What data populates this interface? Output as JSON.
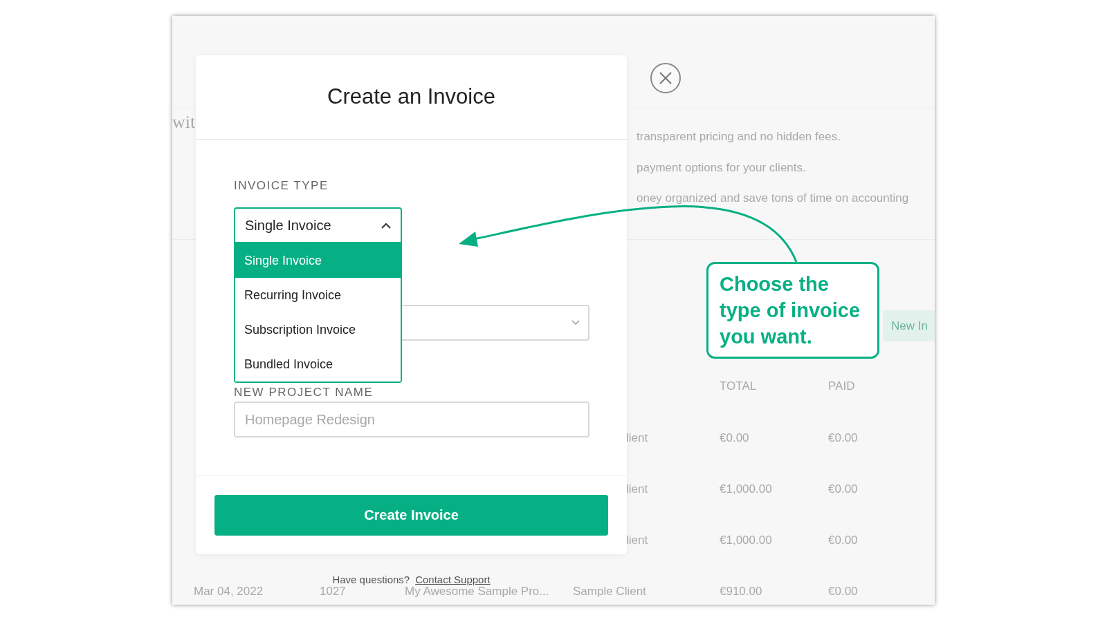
{
  "background_page": {
    "heading_fragment": "wit",
    "features": [
      "transparent pricing and no hidden fees.",
      "payment options for your clients.",
      "oney organized and save tons of time on accounting"
    ],
    "new_button": "New In",
    "table": {
      "columns": [
        "TOTAL",
        "PAID"
      ],
      "rows": [
        {
          "date": "",
          "number": "",
          "project": "",
          "client": "lient",
          "total": "€0.00",
          "paid": "€0.00"
        },
        {
          "date": "",
          "number": "",
          "project": "",
          "client": "lient",
          "total": "€1,000.00",
          "paid": "€0.00"
        },
        {
          "date": "",
          "number": "",
          "project": "",
          "client": "lient",
          "total": "€1,000.00",
          "paid": "€0.00"
        },
        {
          "date": "Mar 04, 2022",
          "number": "1027",
          "project": "My Awesome Sample Pro...",
          "client": "Sample Client",
          "total": "€910.00",
          "paid": "€0.00"
        }
      ]
    }
  },
  "modal": {
    "title": "Create an Invoice",
    "invoice_type": {
      "label": "INVOICE TYPE",
      "value": "Single Invoice",
      "expanded": true,
      "options": [
        {
          "label": "Single Invoice",
          "selected": true
        },
        {
          "label": "Recurring Invoice",
          "selected": false
        },
        {
          "label": "Subscription Invoice",
          "selected": false
        },
        {
          "label": "Bundled Invoice",
          "selected": false
        }
      ]
    },
    "new_project": {
      "label": "NEW PROJECT NAME",
      "placeholder": "Homepage Redesign"
    },
    "submit": "Create Invoice"
  },
  "help": {
    "text": "Have questions?",
    "link": "Contact Support"
  },
  "callout": {
    "text": "Choose the type of invoice you want."
  }
}
